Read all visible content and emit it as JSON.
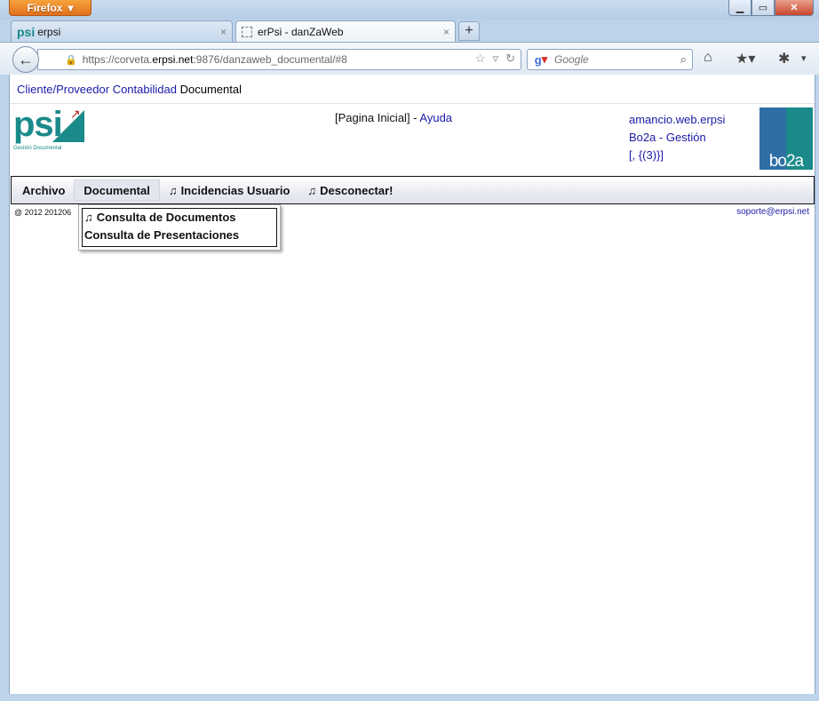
{
  "window": {
    "app_button_label": "Firefox",
    "controls": {
      "minimize": "▁",
      "maximize": "▭",
      "close": "✕"
    }
  },
  "tabs": [
    {
      "favicon_text": "psi",
      "title": "erpsi",
      "close": "×"
    },
    {
      "title": "erPsi - danZaWeb",
      "close": "×"
    }
  ],
  "new_tab_label": "+",
  "navbar": {
    "url_prefix": "https://corveta.",
    "url_host": "erpsi.net",
    "url_rest": ":9876/danzaweb_documental/#8",
    "search_placeholder": "Google",
    "search_engine": "Google"
  },
  "page": {
    "breadcrumb": [
      {
        "label": "Cliente/Proveedor"
      },
      {
        "label": "Contabilidad"
      },
      {
        "label": "Documental"
      }
    ],
    "logo": {
      "text": "psi",
      "tagline": "Gestión Documental"
    },
    "pagina_inicial": "[Pagina Inicial]",
    "separator": " - ",
    "ayuda": "Ayuda",
    "user": "amancio.web.erpsi",
    "company": "Bo2a - Gestión",
    "session_info": "[, {(3)}]",
    "brand_logo_text": "bo2a",
    "menu": [
      {
        "label": "Archivo",
        "note": ""
      },
      {
        "label": "Documental",
        "note": ""
      },
      {
        "label": "Incidencias Usuario",
        "note": "♫"
      },
      {
        "label": "Desconectar!",
        "note": "♫"
      }
    ],
    "dropdown": [
      {
        "label": "Consulta de Documentos",
        "note": "♫"
      },
      {
        "label": "Consulta de Presentaciones",
        "note": ""
      }
    ],
    "copyright": "@ 2012 201206",
    "support_email": "soporte@erpsi.net"
  }
}
